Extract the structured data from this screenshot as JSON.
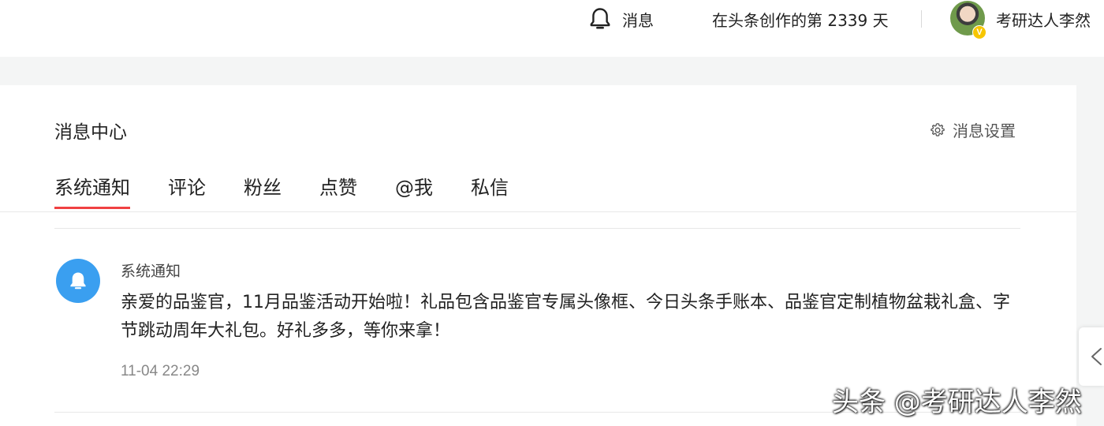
{
  "header": {
    "message_label": "消息",
    "creation_days": "在头条创作的第 2339 天",
    "username": "考研达人李然",
    "verified_badge": "V"
  },
  "panel": {
    "title": "消息中心",
    "settings_label": "消息设置",
    "tabs": [
      {
        "label": "系统通知",
        "active": true
      },
      {
        "label": "评论",
        "active": false
      },
      {
        "label": "粉丝",
        "active": false
      },
      {
        "label": "点赞",
        "active": false
      },
      {
        "label": "@我",
        "active": false
      },
      {
        "label": "私信",
        "active": false
      }
    ]
  },
  "notifications": [
    {
      "source": "系统通知",
      "body": "亲爱的品鉴官，11月品鉴活动开始啦！礼品包含品鉴官专属头像框、今日头条手账本、品鉴官定制植物盆栽礼盒、字节跳动周年大礼包。好礼多多，等你来拿！",
      "time": "11-04 22:29"
    }
  ],
  "watermark": "头条 @考研达人李然",
  "colors": {
    "accent": "#f04142",
    "notification_icon_bg": "#3a9ff0",
    "page_bg": "#f4f5f5"
  }
}
